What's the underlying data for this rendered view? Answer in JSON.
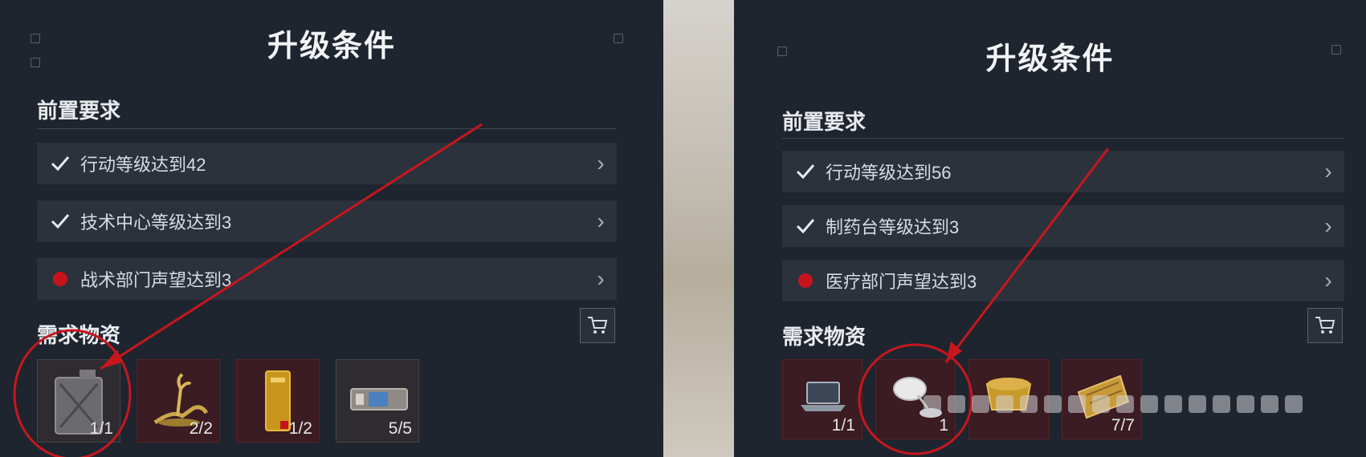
{
  "panels": [
    {
      "title": "升级条件",
      "prereq_title": "前置要求",
      "requirements": [
        {
          "status": "done",
          "label": "行动等级达到42"
        },
        {
          "status": "done",
          "label": "技术中心等级达到3"
        },
        {
          "status": "pending",
          "label": "战术部门声望达到3"
        }
      ],
      "materials_title": "需求物资",
      "items": [
        {
          "icon": "jerry-can-icon",
          "count": "1/1"
        },
        {
          "icon": "golden-deer-statue-icon",
          "count": "2/2"
        },
        {
          "icon": "gold-bar-icon",
          "count": "1/2"
        },
        {
          "icon": "electronic-module-icon",
          "count": "5/5"
        }
      ]
    },
    {
      "title": "升级条件",
      "prereq_title": "前置要求",
      "requirements": [
        {
          "status": "done",
          "label": "行动等级达到56"
        },
        {
          "status": "done",
          "label": "制药台等级达到3"
        },
        {
          "status": "pending",
          "label": "医疗部门声望达到3"
        }
      ],
      "materials_title": "需求物资",
      "items": [
        {
          "icon": "laptop-icon",
          "count": "1/1"
        },
        {
          "icon": "medical-lamp-icon",
          "count": "1"
        },
        {
          "icon": "golden-artifact-icon",
          "count": ""
        },
        {
          "icon": "golden-scroll-icon",
          "count": "7/7"
        }
      ]
    }
  ],
  "colors": {
    "panel_bg": "#1f252f",
    "row_bg": "#2b323c",
    "pending_dot": "#c7141c",
    "annotation": "#c8161e",
    "item_bg": "#3a1c22"
  }
}
